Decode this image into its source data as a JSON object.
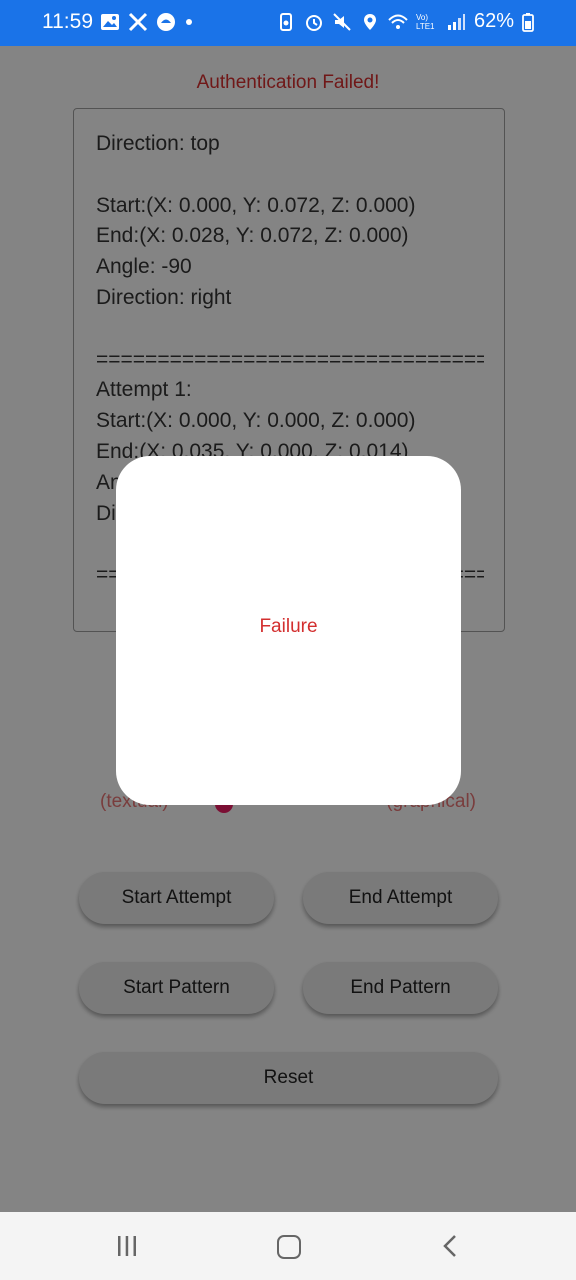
{
  "status_bar": {
    "time": "11:59",
    "battery": "62%",
    "network_label": "Vo) LTE1",
    "icons_left": [
      "gallery-icon",
      "x-icon",
      "app-icon",
      "dot-icon"
    ],
    "icons_right": [
      "battery-saver-icon",
      "alarm-icon",
      "mute-icon",
      "location-icon",
      "wifi-icon",
      "signal-icon",
      "battery-icon"
    ]
  },
  "app": {
    "title": "Authentication Failed!",
    "log_text": "Direction: top\n\nStart:(X: 0.000, Y: 0.072, Z: 0.000)\nEnd:(X: 0.028, Y: 0.072, Z: 0.000)\nAngle: -90\nDirection: right\n\n================================\nAttempt 1:\nStart:(X: 0.000, Y: 0.000, Z: 0.000)\nEnd:(X: 0.035, Y: 0.000, Z: 0.014)\nAngle: -90\nDirection: right\n\n================================",
    "mode_left": "(textual)",
    "mode_right": "(graphical)",
    "buttons": {
      "start_attempt": "Start Attempt",
      "end_attempt": "End Attempt",
      "start_pattern": "Start Pattern",
      "end_pattern": "End Pattern",
      "reset": "Reset"
    }
  },
  "dialog": {
    "message": "Failure"
  },
  "colors": {
    "status_bar": "#1a73e8",
    "error_red": "#d32f2f",
    "switch_thumb": "#e91e63"
  }
}
